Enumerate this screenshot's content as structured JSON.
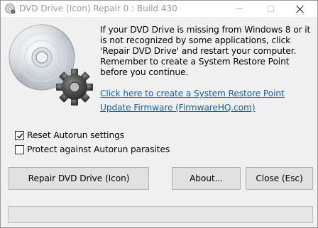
{
  "window": {
    "title": "DVD Drive (Icon) Repair 0 : Build 430"
  },
  "main": {
    "info_text": "If your DVD Drive is missing from Windows 8 or it is not recognized by some applications, click 'Repair DVD Drive' and restart your computer. Remember to create a System Restore Point before you continue.",
    "restore_link": "Click here to create a System Restore Point",
    "firmware_link": "Update Firmware (FirmwareHQ.com)"
  },
  "options": {
    "reset_autorun": {
      "label": "Reset Autorun settings",
      "checked": true
    },
    "protect_autorun": {
      "label": "Protect against Autorun parasites",
      "checked": false
    }
  },
  "buttons": {
    "repair": "Repair DVD Drive (Icon)",
    "about": "About...",
    "close": "Close (Esc)"
  },
  "status": {
    "progress": 0
  },
  "colors": {
    "link": "#0066cc",
    "background": "#f0f0f0"
  },
  "icons": {
    "app": "dvd-gear-icon",
    "logo": "disc-gear-icon"
  }
}
